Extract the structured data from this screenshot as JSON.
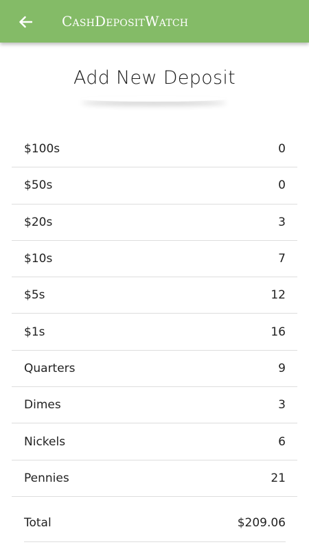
{
  "app_bar": {
    "title": "CashDepositWatch",
    "back_icon": "arrow-left-icon",
    "color": "#84bb67"
  },
  "heading": "Add New Deposit",
  "denominations": [
    {
      "label": "$100s",
      "count": "0"
    },
    {
      "label": "$50s",
      "count": "0"
    },
    {
      "label": "$20s",
      "count": "3"
    },
    {
      "label": "$10s",
      "count": "7"
    },
    {
      "label": "$5s",
      "count": "12"
    },
    {
      "label": "$1s",
      "count": "16"
    },
    {
      "label": "Quarters",
      "count": "9"
    },
    {
      "label": "Dimes",
      "count": "3"
    },
    {
      "label": "Nickels",
      "count": "6"
    },
    {
      "label": "Pennies",
      "count": "21"
    }
  ],
  "total": {
    "label": "Total",
    "value": "$209.06"
  }
}
